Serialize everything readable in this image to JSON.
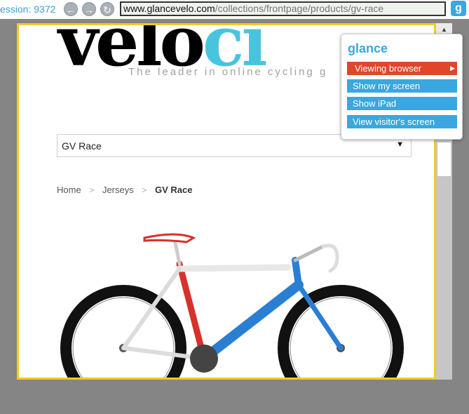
{
  "toolbar": {
    "session_label": "ession: 9372",
    "url_host": "www.glancevelo.com",
    "url_path": "/collections/frontpage/products/gv-race",
    "back_glyph": "←",
    "forward_glyph": "→",
    "refresh_glyph": "↻",
    "logo_glyph": "g"
  },
  "site": {
    "logo_text_left": "velo",
    "logo_text_right": "ci",
    "tagline": "The leader in online cycling g",
    "product_select_value": "GV Race",
    "breadcrumb": {
      "home": "Home",
      "category": "Jerseys",
      "current": "GV Race",
      "separator": ">"
    }
  },
  "glance_panel": {
    "brand": "glance",
    "menu": [
      {
        "label": "Viewing browser",
        "style": "red",
        "has_arrow": true
      },
      {
        "label": "Show my screen",
        "style": "blue"
      },
      {
        "label": "Show iPad",
        "style": "blue"
      },
      {
        "label": "View visitor's screen",
        "style": "blue"
      }
    ]
  },
  "colors": {
    "accent_blue": "#3aa7e0",
    "active_red": "#e0462a",
    "viewer_border": "#f0cb24",
    "bike_red": "#d8302a",
    "bike_blue": "#2a7fd3"
  }
}
